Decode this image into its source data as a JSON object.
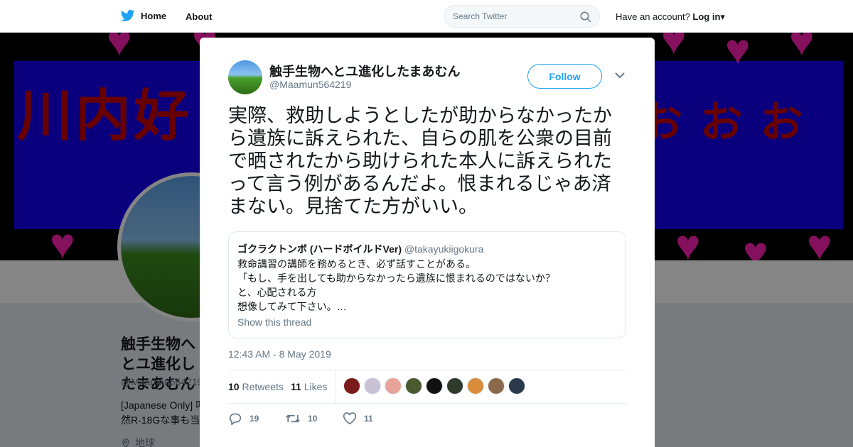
{
  "nav": {
    "home_label": "Home",
    "about_label": "About",
    "search_placeholder": "Search Twitter",
    "account_prompt": "Have an account?",
    "login_label": "Log in"
  },
  "background_profile": {
    "name": "触手生物へとユ進化したまあむん",
    "handle": "@Maamun564219",
    "bio_line1": "[Japanese Only] 叫",
    "bio_line2": "然R-18Gな事も当",
    "location": "地球",
    "banner_left_text": "川内好",
    "banner_right_text": "お お お"
  },
  "tweet": {
    "author_name": "触手生物へとユ進化したまあむん",
    "author_handle": "@Maamun564219",
    "follow_label": "Follow",
    "text": "実際、救助しようとしたが助からなかったから遺族に訴えられた、自らの肌を公衆の目前で晒されたから助けられた本人に訴えられたって言う例があるんだよ。恨まれるじゃあ済まない。見捨てた方がいい。",
    "timestamp": "12:43 AM - 8 May 2019",
    "quoted": {
      "name": "ゴクラクトンボ (ハードボイルドVer)",
      "handle": "@takayukiigokura",
      "lines": [
        "救命講習の講師を務めるとき、必ず話すことがある。",
        "「もし、手を出しても助からなかったら遺族に恨まれるのではないか？",
        "と、心配される方",
        "想像してみて下さい。…"
      ],
      "thread_link": "Show this thread"
    },
    "retweets_count": "10",
    "retweets_label": "Retweets",
    "likes_count": "11",
    "likes_label": "Likes",
    "reply_count": "19",
    "retweet_action_count": "10",
    "like_action_count": "11",
    "liker_colors": [
      "#7a1a1a",
      "#c9c2d6",
      "#e8a49a",
      "#4a5a2e",
      "#111111",
      "#2e3a2a",
      "#d98c3a",
      "#8a6a4a",
      "#2a3a4a"
    ]
  },
  "colors": {
    "accent": "#1da1f2",
    "banner_blue": "#1400f0",
    "banner_red": "#c80000",
    "heart_pink": "#ff1fb4"
  }
}
